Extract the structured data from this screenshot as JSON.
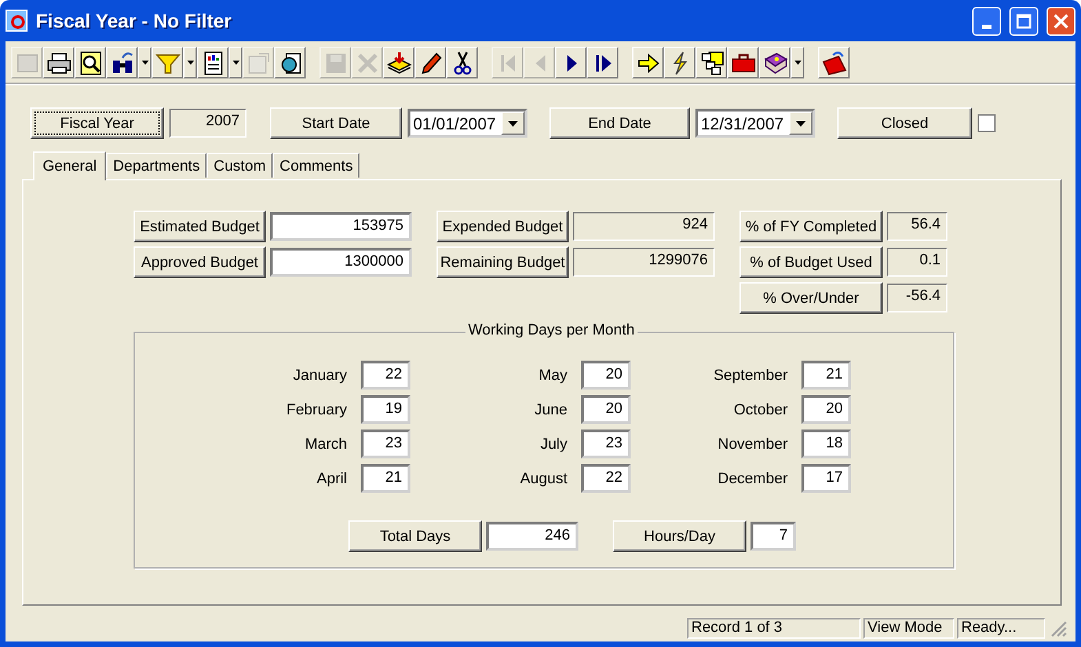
{
  "window": {
    "title": "Fiscal Year - No Filter"
  },
  "toolbar": [
    [
      {
        "kind": "blank",
        "disabled": true
      },
      {
        "kind": "print",
        "disabled": false
      },
      {
        "kind": "preview",
        "disabled": false
      },
      {
        "kind": "binoculars",
        "disabled": false
      },
      {
        "kind": "dropdown",
        "disabled": false
      },
      {
        "kind": "filter",
        "disabled": false
      },
      {
        "kind": "dropdown",
        "disabled": false
      },
      {
        "kind": "report",
        "disabled": false
      },
      {
        "kind": "dropdown",
        "disabled": false
      },
      {
        "kind": "form",
        "disabled": true
      },
      {
        "kind": "copy",
        "disabled": false
      }
    ],
    [
      {
        "kind": "save",
        "disabled": true
      },
      {
        "kind": "delete",
        "disabled": true
      },
      {
        "kind": "stack",
        "disabled": false
      },
      {
        "kind": "pencil",
        "disabled": false
      },
      {
        "kind": "scissors",
        "disabled": false
      }
    ],
    [
      {
        "kind": "first",
        "disabled": true
      },
      {
        "kind": "prev",
        "disabled": true
      },
      {
        "kind": "next",
        "disabled": false
      },
      {
        "kind": "last",
        "disabled": false
      }
    ],
    [
      {
        "kind": "goto",
        "disabled": false
      },
      {
        "kind": "lightning",
        "disabled": false
      },
      {
        "kind": "tree",
        "disabled": false
      },
      {
        "kind": "toolbox",
        "disabled": false
      },
      {
        "kind": "book",
        "disabled": false
      },
      {
        "kind": "dropdown",
        "disabled": false
      }
    ],
    [
      {
        "kind": "exit",
        "disabled": false
      }
    ]
  ],
  "header": {
    "fiscal_year": {
      "label": "Fiscal Year",
      "value": "2007"
    },
    "start_date": {
      "label": "Start Date",
      "value": "01/01/2007"
    },
    "end_date": {
      "label": "End Date",
      "value": "12/31/2007"
    },
    "closed": {
      "label": "Closed",
      "checked": false
    }
  },
  "tabs": [
    {
      "label": "General",
      "selected": true
    },
    {
      "label": "Departments",
      "selected": false
    },
    {
      "label": "Custom",
      "selected": false
    },
    {
      "label": "Comments",
      "selected": false
    }
  ],
  "budget": [
    [
      {
        "label": "Estimated Budget",
        "value": "153975",
        "readonly": false
      },
      {
        "label": "Approved Budget",
        "value": "1300000",
        "readonly": false
      }
    ],
    [
      {
        "label": "Expended Budget",
        "value": "924",
        "readonly": true
      },
      {
        "label": "Remaining Budget",
        "value": "1299076",
        "readonly": true
      }
    ],
    [
      {
        "label": "% of FY Completed",
        "value": "56.4",
        "readonly": true
      },
      {
        "label": "% of Budget Used",
        "value": "0.1",
        "readonly": true
      },
      {
        "label": "% Over/Under",
        "value": "-56.4",
        "readonly": true
      }
    ]
  ],
  "working_days": {
    "title": "Working Days per Month",
    "months": [
      {
        "name": "January",
        "value": "22"
      },
      {
        "name": "February",
        "value": "19"
      },
      {
        "name": "March",
        "value": "23"
      },
      {
        "name": "April",
        "value": "21"
      },
      {
        "name": "May",
        "value": "20"
      },
      {
        "name": "June",
        "value": "20"
      },
      {
        "name": "July",
        "value": "23"
      },
      {
        "name": "August",
        "value": "22"
      },
      {
        "name": "September",
        "value": "21"
      },
      {
        "name": "October",
        "value": "20"
      },
      {
        "name": "November",
        "value": "18"
      },
      {
        "name": "December",
        "value": "17"
      }
    ],
    "total": {
      "label": "Total Days",
      "value": "246"
    },
    "hours": {
      "label": "Hours/Day",
      "value": "7"
    }
  },
  "status_bar": [
    "Record 1 of 3",
    "View Mode",
    "Ready..."
  ]
}
